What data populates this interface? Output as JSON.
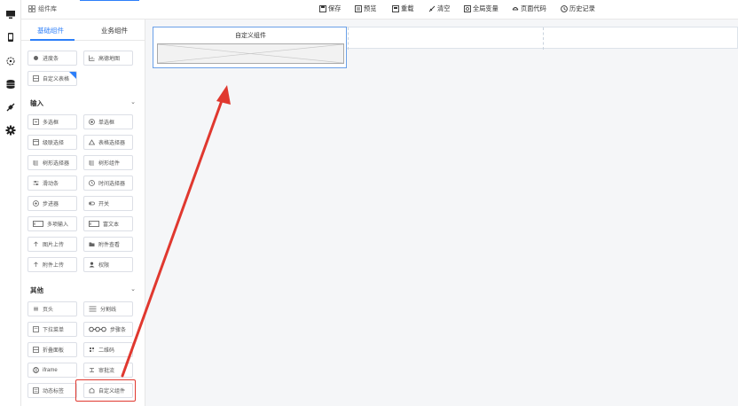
{
  "rail": {
    "items": [
      {
        "name": "desktop-icon"
      },
      {
        "name": "mobile-icon"
      },
      {
        "name": "network-icon"
      },
      {
        "name": "database-icon"
      },
      {
        "name": "plugin-icon"
      },
      {
        "name": "gear-icon"
      }
    ]
  },
  "topbar": {
    "library_title": "组件库",
    "tools": [
      {
        "label": "保存",
        "icon": "save-icon"
      },
      {
        "label": "预览",
        "icon": "preview-icon"
      },
      {
        "label": "重载",
        "icon": "reload-icon"
      },
      {
        "label": "清空",
        "icon": "clear-icon"
      },
      {
        "label": "全局变量",
        "icon": "variable-icon"
      },
      {
        "label": "页面代码",
        "icon": "code-icon"
      },
      {
        "label": "历史记录",
        "icon": "history-icon"
      }
    ]
  },
  "panel": {
    "tabs": [
      {
        "label": "基础组件",
        "active": true
      },
      {
        "label": "业务组件",
        "active": false
      }
    ],
    "top_items": [
      {
        "label": "进度条",
        "icon": "progress-icon"
      },
      {
        "label": "高德地图",
        "icon": "map-icon"
      },
      {
        "label": "自定义表格",
        "icon": "table-icon"
      }
    ],
    "section_input": "输入",
    "input_items": [
      {
        "label": "多选框",
        "icon": "checkbox-icon"
      },
      {
        "label": "单选框",
        "icon": "radio-icon"
      },
      {
        "label": "级联选择",
        "icon": "cascader-icon"
      },
      {
        "label": "表格选择器",
        "icon": "table-picker-icon"
      },
      {
        "label": "树形选择器",
        "icon": "tree-select-icon"
      },
      {
        "label": "树形组件",
        "icon": "tree-icon"
      },
      {
        "label": "滑动条",
        "icon": "slider-icon"
      },
      {
        "label": "时间选择器",
        "icon": "clock-icon"
      },
      {
        "label": "步进器",
        "icon": "stepper-icon"
      },
      {
        "label": "开关",
        "icon": "switch-icon"
      },
      {
        "label": "多项输入",
        "icon": "multi-input-icon"
      },
      {
        "label": "富文本",
        "icon": "rich-text-icon"
      },
      {
        "label": "图片上传",
        "icon": "upload-icon"
      },
      {
        "label": "附件查看",
        "icon": "folder-icon"
      },
      {
        "label": "附件上传",
        "icon": "upload-icon"
      },
      {
        "label": "权限",
        "icon": "user-icon"
      }
    ],
    "section_other": "其他",
    "other_items": [
      {
        "label": "页头",
        "icon": "header-icon"
      },
      {
        "label": "分割线",
        "icon": "divider-icon"
      },
      {
        "label": "下拉菜单",
        "icon": "dropdown-icon"
      },
      {
        "label": "步骤条",
        "icon": "steps-icon"
      },
      {
        "label": "折叠面板",
        "icon": "collapse-icon"
      },
      {
        "label": "二维码",
        "icon": "qrcode-icon"
      },
      {
        "label": "iframe",
        "icon": "globe-icon"
      },
      {
        "label": "审批流",
        "icon": "flow-icon"
      },
      {
        "label": "动态标签",
        "icon": "tag-icon"
      },
      {
        "label": "自定义组件",
        "icon": "custom-icon"
      }
    ]
  },
  "canvas": {
    "placed_component_title": "自定义组件"
  },
  "colors": {
    "accent": "#2d7ff9",
    "annotation": "#e0382f"
  }
}
